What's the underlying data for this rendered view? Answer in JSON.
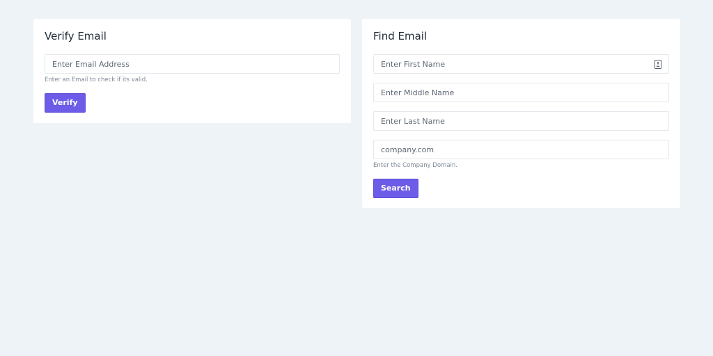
{
  "verify": {
    "title": "Verify Email",
    "email_placeholder": "Enter Email Address",
    "email_value": "",
    "help": "Enter an Email to check if its valid.",
    "button_label": "Verify"
  },
  "find": {
    "title": "Find Email",
    "first_name_placeholder": "Enter First Name",
    "first_name_value": "",
    "middle_name_placeholder": "Enter Middle Name",
    "middle_name_value": "",
    "last_name_placeholder": "Enter Last Name",
    "last_name_value": "",
    "domain_placeholder": "company.com",
    "domain_value": "",
    "help": "Enter the Company Domain.",
    "button_label": "Search",
    "autofill_icon": "contact-card-icon"
  },
  "colors": {
    "page_background": "#edf3f6",
    "card_background": "#ffffff",
    "button": "#6c5ce7",
    "help_text": "#7b8794"
  }
}
